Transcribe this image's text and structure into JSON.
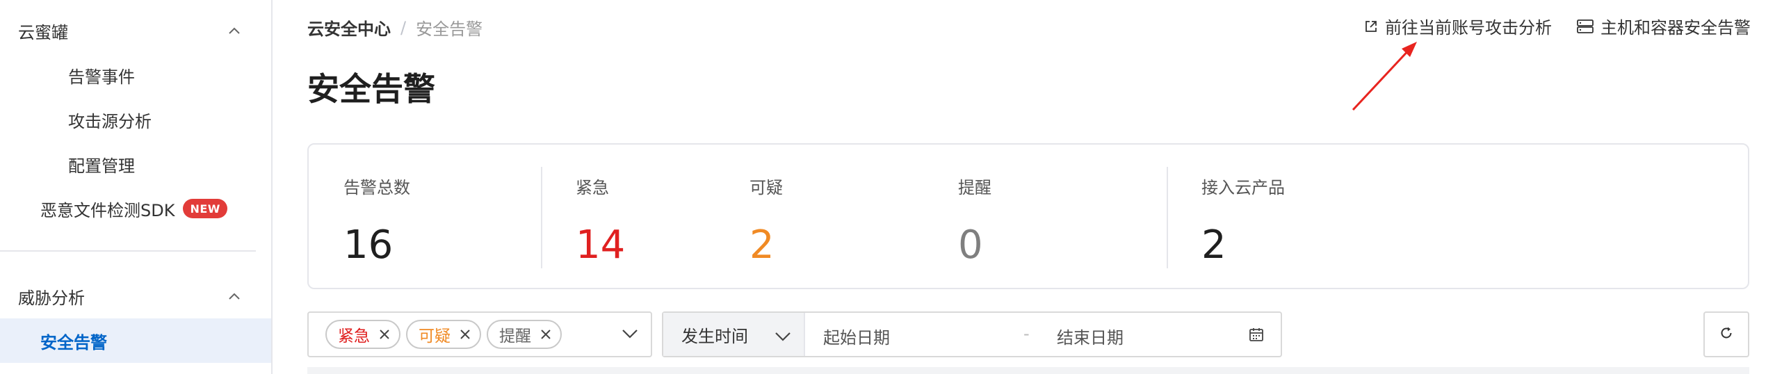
{
  "sidebar": {
    "honeypot_group": "云蜜罐",
    "honeypot_items": [
      "告警事件",
      "攻击源分析",
      "配置管理"
    ],
    "sdk_item": "恶意文件检测SDK",
    "sdk_badge": "NEW",
    "threat_group": "威胁分析",
    "active_item": "安全告警"
  },
  "breadcrumb": {
    "root": "云安全中心",
    "separator": "/",
    "current": "安全告警"
  },
  "page_title": "安全告警",
  "top_actions": {
    "attack_analysis": "前往当前账号攻击分析",
    "host_container": "主机和容器安全告警"
  },
  "stats": {
    "total": {
      "label": "告警总数",
      "value": "16"
    },
    "urgent": {
      "label": "紧急",
      "value": "14",
      "color": "#e02020"
    },
    "suspicious": {
      "label": "可疑",
      "value": "2",
      "color": "#f08a24"
    },
    "reminder": {
      "label": "提醒",
      "value": "0",
      "color": "#7f7f7f"
    },
    "products": {
      "label": "接入云产品",
      "value": "2"
    }
  },
  "filters": {
    "severity_tags": [
      {
        "label": "紧急",
        "color": "#e02020"
      },
      {
        "label": "可疑",
        "color": "#f08a24"
      },
      {
        "label": "提醒",
        "color": "#666666"
      }
    ],
    "time_type": "发生时间",
    "start_placeholder": "起始日期",
    "range_separator": "-",
    "end_placeholder": "结束日期"
  },
  "icons": {
    "external_link": "external-link-icon",
    "server": "server-icon",
    "chevron_up": "chevron-up-icon",
    "chevron_down": "chevron-down-icon",
    "close": "close-icon",
    "calendar": "calendar-icon",
    "refresh": "refresh-icon"
  }
}
